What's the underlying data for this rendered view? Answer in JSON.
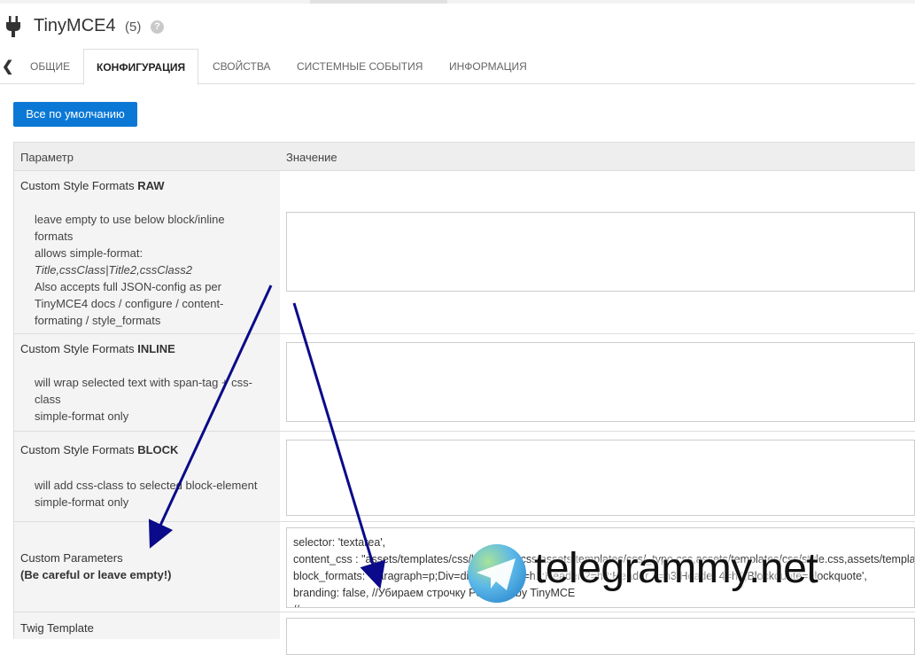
{
  "header": {
    "title": "TinyMCE4",
    "count": "(5)",
    "help": "?"
  },
  "tabs": [
    {
      "label": "ОБЩИЕ"
    },
    {
      "label": "КОНФИГУРАЦИЯ"
    },
    {
      "label": "СВОЙСТВА"
    },
    {
      "label": "СИСТЕМНЫЕ СОБЫТИЯ"
    },
    {
      "label": "ИНФОРМАЦИЯ"
    }
  ],
  "default_button": "Все по умолчанию",
  "table": {
    "col_param": "Параметр",
    "col_value": "Значение",
    "rows": [
      {
        "name_prefix": "Custom Style Formats ",
        "name_bold": "RAW",
        "desc": [
          "leave empty to use below block/inline",
          "formats",
          "allows simple-format:",
          "Title,cssClass|Title2,cssClass2",
          "Also accepts full JSON-config as per",
          "TinyMCE4 docs / configure / content-",
          "formating / style_formats"
        ]
      },
      {
        "name_prefix": "Custom Style Formats ",
        "name_bold": "INLINE",
        "desc": [
          "will wrap selected text with span-tag + css-",
          "class",
          "simple-format only"
        ]
      },
      {
        "name_prefix": "Custom Style Formats ",
        "name_bold": "BLOCK",
        "desc": [
          "will add css-class to selected block-element",
          "simple-format only"
        ]
      },
      {
        "name": "Custom Parameters",
        "note": "(Be careful or leave empty!)",
        "code": [
          "selector: 'textarea',",
          "content_css : \"assets/templates/css/bootstrap.css,assets/templates/css/_typo.css,assets/templates/css/style.css,assets/templa",
          "block_formats: 'Paragraph=p;Div=div;Header 1=h1;Header 2=h2;Header 3=h3;Header 4=h4;Blockquote=blockquote',",
          "branding: false, //Убираем строчку Powered by TinyMCE",
          "//..."
        ]
      },
      {
        "name": "Twig Template"
      }
    ]
  },
  "watermark": "telegrammy.net"
}
